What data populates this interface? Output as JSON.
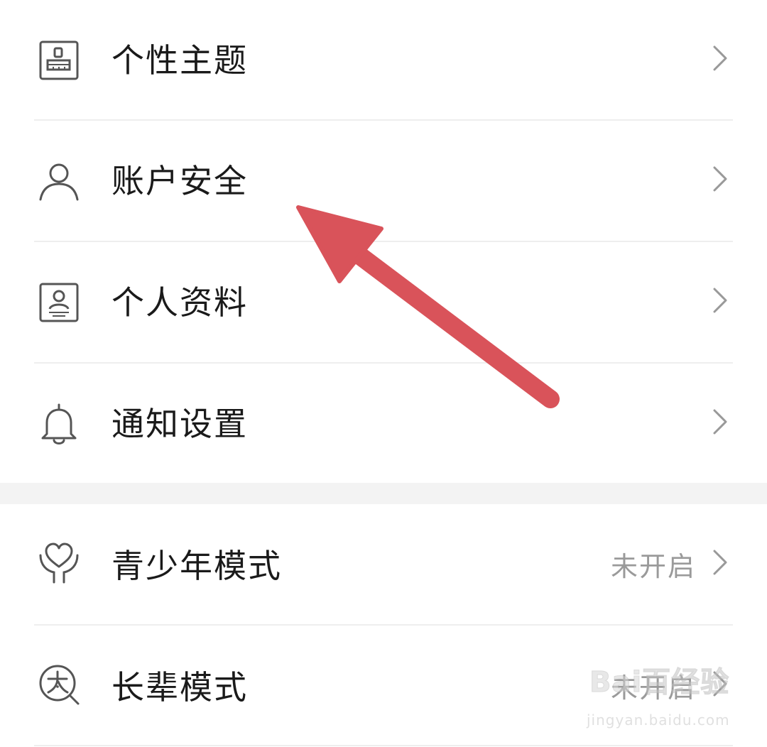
{
  "settings_group_1": [
    {
      "id": "theme",
      "label": "个性主题",
      "icon": "brush-icon"
    },
    {
      "id": "account-security",
      "label": "账户安全",
      "icon": "user-icon"
    },
    {
      "id": "profile",
      "label": "个人资料",
      "icon": "id-card-icon"
    },
    {
      "id": "notifications",
      "label": "通知设置",
      "icon": "bell-icon"
    }
  ],
  "settings_group_2": [
    {
      "id": "teen-mode",
      "label": "青少年模式",
      "value": "未开启",
      "icon": "heart-hands-icon"
    },
    {
      "id": "elder-mode",
      "label": "长辈模式",
      "value": "未开启",
      "icon": "large-text-icon"
    }
  ],
  "watermark": {
    "logo": "Bai百经验",
    "url": "jingyan.baidu.com"
  },
  "colors": {
    "text": "#1a1a1a",
    "secondary_text": "#9a9a9a",
    "icon": "#555555",
    "divider": "#eeeeee",
    "section_gap": "#f3f3f3",
    "annotation_arrow": "#d9535a"
  }
}
